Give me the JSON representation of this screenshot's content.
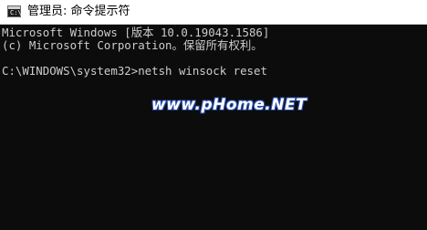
{
  "window": {
    "title": "管理员: 命令提示符",
    "icon": "cmd-icon"
  },
  "console": {
    "lines": [
      "Microsoft Windows [版本 10.0.19043.1586]",
      "(c) Microsoft Corporation。保留所有权利。",
      "",
      "C:\\WINDOWS\\system32>netsh winsock reset"
    ]
  },
  "watermark": {
    "text": "www.pHome.NET"
  },
  "colors": {
    "background": "#0c0c0c",
    "text": "#cccccc",
    "titlebar": "#ffffff"
  }
}
